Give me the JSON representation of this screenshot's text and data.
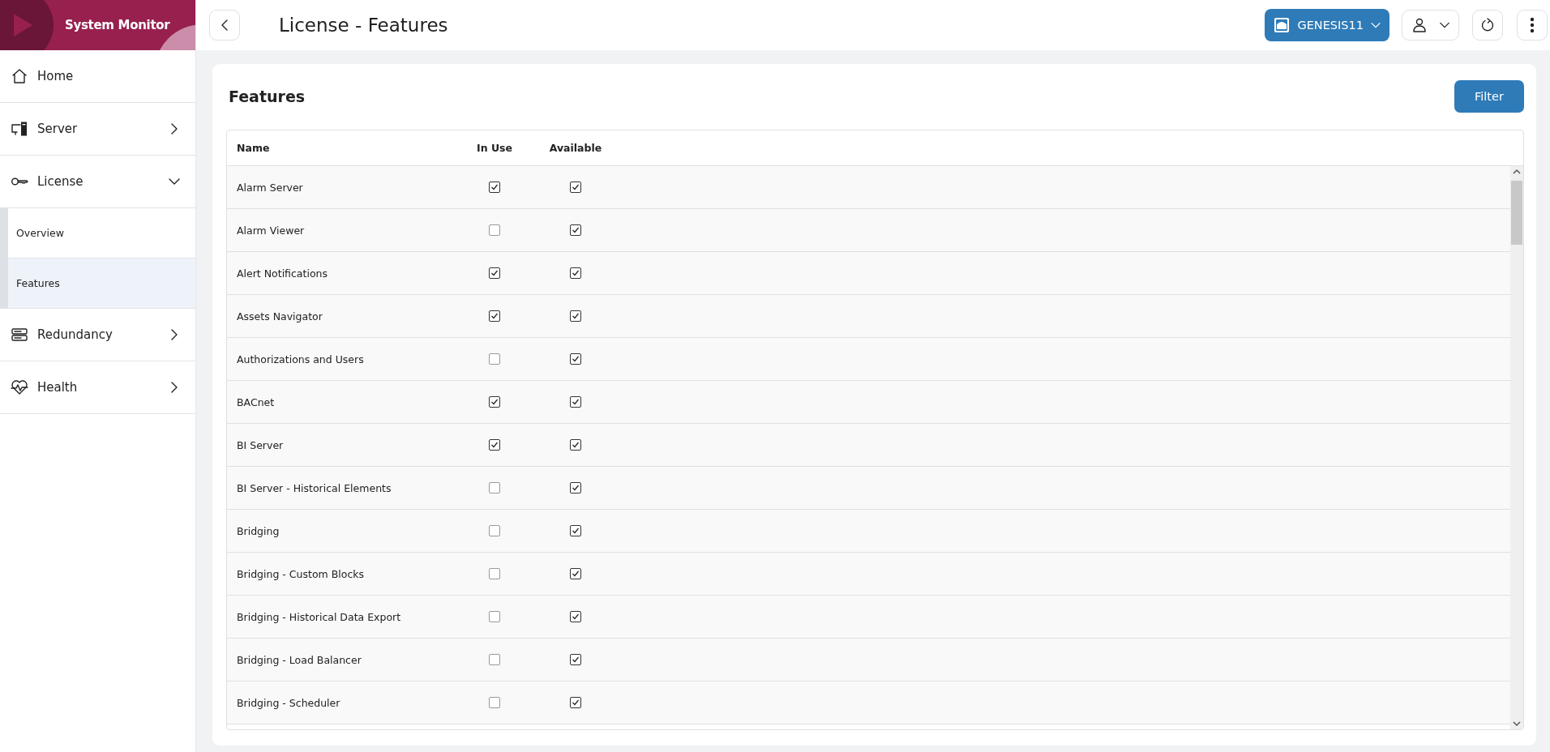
{
  "app": {
    "title": "System Monitor"
  },
  "sidebar": {
    "items": [
      {
        "label": "Home",
        "kind": "link"
      },
      {
        "label": "Server",
        "kind": "group",
        "expanded": false
      },
      {
        "label": "License",
        "kind": "group",
        "expanded": true,
        "children": [
          {
            "label": "Overview",
            "selected": false
          },
          {
            "label": "Features",
            "selected": true
          }
        ]
      },
      {
        "label": "Redundancy",
        "kind": "group",
        "expanded": false
      },
      {
        "label": "Health",
        "kind": "group",
        "expanded": false
      }
    ]
  },
  "header": {
    "title": "License - Features",
    "server_button": "GENESIS11"
  },
  "card": {
    "title": "Features",
    "filter_button": "Filter"
  },
  "table": {
    "columns": [
      "Name",
      "In Use",
      "Available"
    ],
    "rows": [
      {
        "name": "Alarm Server",
        "in_use": true,
        "available": true
      },
      {
        "name": "Alarm Viewer",
        "in_use": false,
        "available": true
      },
      {
        "name": "Alert Notifications",
        "in_use": true,
        "available": true
      },
      {
        "name": "Assets Navigator",
        "in_use": true,
        "available": true
      },
      {
        "name": "Authorizations and Users",
        "in_use": false,
        "available": true
      },
      {
        "name": "BACnet",
        "in_use": true,
        "available": true
      },
      {
        "name": "BI Server",
        "in_use": true,
        "available": true
      },
      {
        "name": "BI Server - Historical Elements",
        "in_use": false,
        "available": true
      },
      {
        "name": "Bridging",
        "in_use": false,
        "available": true
      },
      {
        "name": "Bridging - Custom Blocks",
        "in_use": false,
        "available": true
      },
      {
        "name": "Bridging - Historical Data Export",
        "in_use": false,
        "available": true
      },
      {
        "name": "Bridging - Load Balancer",
        "in_use": false,
        "available": true
      },
      {
        "name": "Bridging - Scheduler",
        "in_use": false,
        "available": true
      }
    ]
  }
}
